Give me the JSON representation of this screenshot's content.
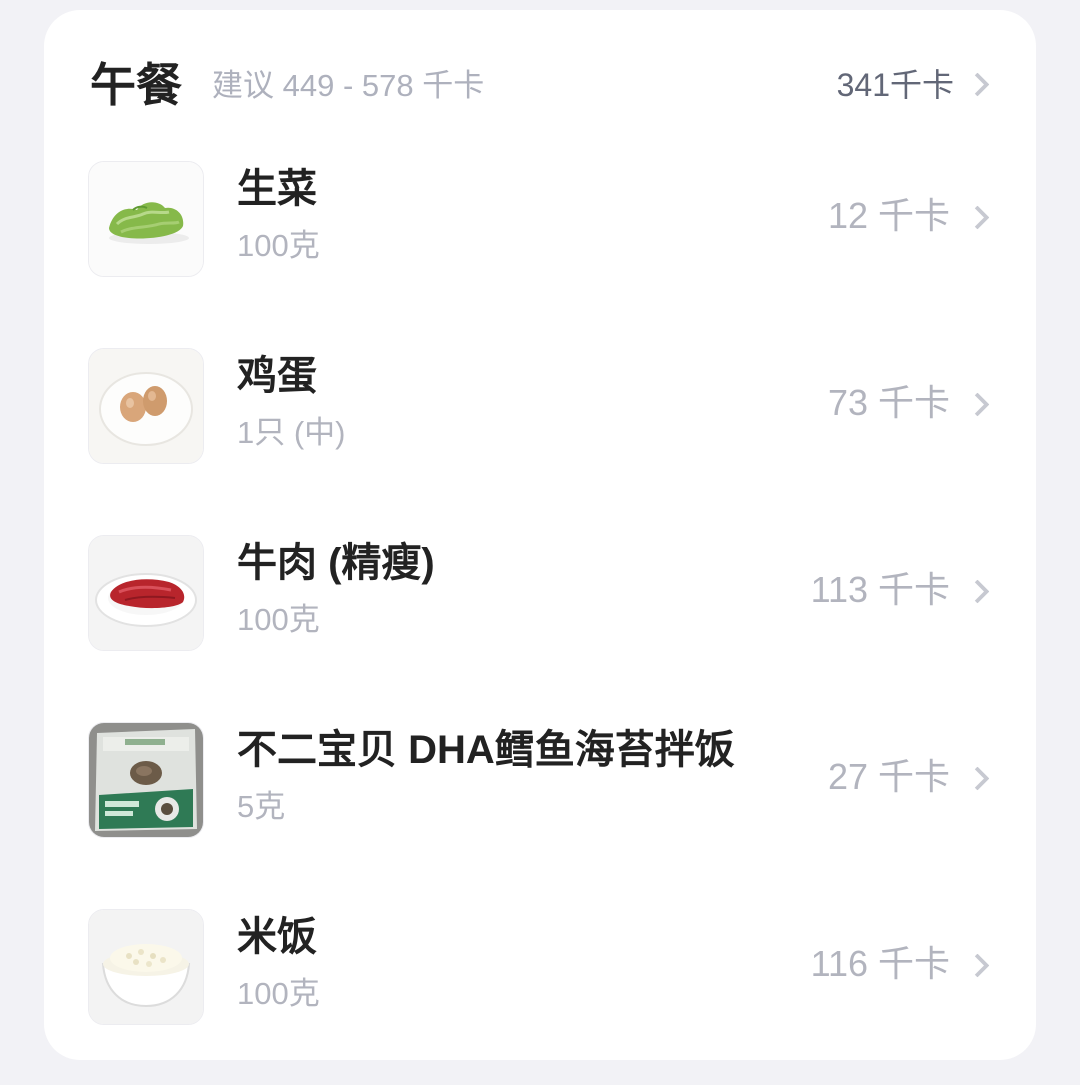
{
  "meal": {
    "title": "午餐",
    "suggestion": "建议 449 - 578 千卡",
    "total": "341千卡"
  },
  "foods": [
    {
      "name": "生菜",
      "amount": "100克",
      "kcal": "12 千卡",
      "icon": "lettuce-image"
    },
    {
      "name": "鸡蛋",
      "amount": "1只 (中)",
      "kcal": "73 千卡",
      "icon": "eggs-image"
    },
    {
      "name": "牛肉 (精瘦)",
      "amount": "100克",
      "kcal": "113 千卡",
      "icon": "beef-image"
    },
    {
      "name": "不二宝贝 DHA鳕鱼海苔拌饭",
      "amount": "5克",
      "kcal": "27 千卡",
      "icon": "seasoning-packet-image"
    },
    {
      "name": "米饭",
      "amount": "100克",
      "kcal": "116 千卡",
      "icon": "rice-bowl-image"
    }
  ],
  "colors": {
    "background": "#f2f2f6",
    "card": "#ffffff",
    "primary_text": "#222222",
    "secondary_text": "#b2b4be",
    "total_text": "#626777"
  }
}
